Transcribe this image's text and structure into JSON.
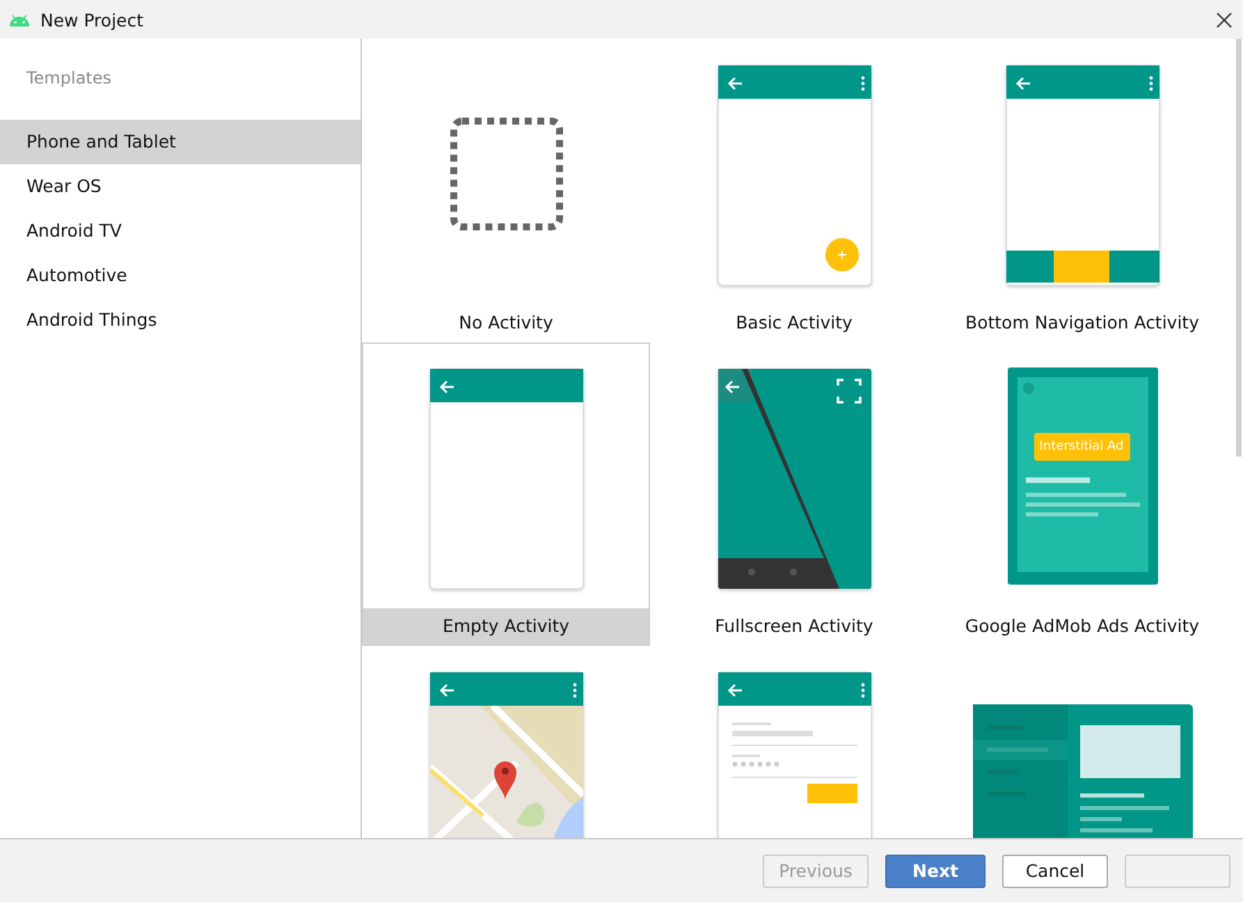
{
  "window": {
    "title": "New Project"
  },
  "sidebar": {
    "heading": "Templates",
    "items": [
      {
        "label": "Phone and Tablet",
        "selected": true
      },
      {
        "label": "Wear OS",
        "selected": false
      },
      {
        "label": "Android TV",
        "selected": false
      },
      {
        "label": "Automotive",
        "selected": false
      },
      {
        "label": "Android Things",
        "selected": false
      }
    ]
  },
  "templates": [
    {
      "kind": "none",
      "label": "No Activity",
      "selected": false
    },
    {
      "kind": "basic",
      "label": "Basic Activity",
      "selected": false
    },
    {
      "kind": "bottom_nav",
      "label": "Bottom Navigation Activity",
      "selected": false
    },
    {
      "kind": "empty",
      "label": "Empty Activity",
      "selected": true
    },
    {
      "kind": "fullscreen",
      "label": "Fullscreen Activity",
      "selected": false
    },
    {
      "kind": "admob",
      "label": "Google AdMob Ads Activity",
      "ad_text": "Interstitial Ad",
      "selected": false
    },
    {
      "kind": "maps",
      "selected": false
    },
    {
      "kind": "login",
      "selected": false
    },
    {
      "kind": "master_detail",
      "selected": false
    }
  ],
  "buttons": [
    {
      "label": "Previous",
      "disabled": true,
      "primary": false
    },
    {
      "label": "Next",
      "disabled": false,
      "primary": true
    },
    {
      "label": "Cancel",
      "disabled": false,
      "primary": false
    },
    {
      "disabled": true,
      "primary": false
    }
  ]
}
